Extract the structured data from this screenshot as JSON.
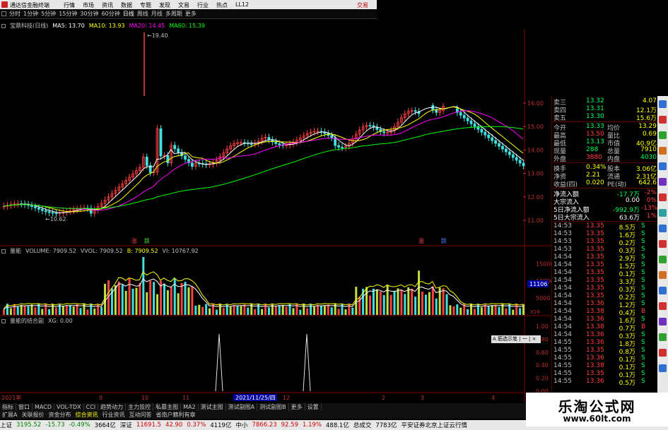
{
  "titlebar": {
    "title": "通达信金融终端",
    "menu": [
      "行情",
      "市场",
      "资讯",
      "数据",
      "专题",
      "发现",
      "文易",
      "行业",
      "热点",
      "LL12"
    ],
    "trade": "交易"
  },
  "toolbar": {
    "items": [
      "分时",
      "1分钟",
      "5分钟",
      "15分钟",
      "30分钟",
      "60分钟",
      "日线",
      "周线",
      "月线",
      "多周期",
      "更多"
    ],
    "selected_index": 6
  },
  "main_chart": {
    "stock": "宝鼎科技(日线)",
    "ma": [
      {
        "label": "MA5: 13.70",
        "color": "#ffffff"
      },
      {
        "label": "MA10: 13.93",
        "color": "#ffff00"
      },
      {
        "label": "MA20: 14.45",
        "color": "#ff00ff"
      },
      {
        "label": "MA60: 15.39",
        "color": "#00ff00"
      }
    ],
    "high_label": "19.40",
    "low_label": "10.62",
    "y_ticks": [
      "16.00",
      "15.00",
      "14.00",
      "13.00",
      "12.00",
      "11.00"
    ],
    "signal_marks": [
      "涨",
      "跌",
      "涨",
      "跌"
    ]
  },
  "volume_chart": {
    "title": "量能",
    "labels": [
      {
        "text": "VOLUME: 7909.52",
        "color": "#c0c0c0"
      },
      {
        "text": "VVOL: 7909.52",
        "color": "#c0c0c0"
      },
      {
        "text": "B: 7909.52",
        "color": "#ffff00"
      },
      {
        "text": "VI: 10767.92",
        "color": "#c0c0c0"
      }
    ],
    "y_ticks": [
      "15000",
      "10000",
      "5000"
    ],
    "highlight": "11106",
    "unit": "X10"
  },
  "signal_chart": {
    "title": "量能的结合副",
    "label": "XG: 0.00",
    "y_ticks": [
      "1.00",
      "0.80",
      "0.60",
      "0.40",
      "0.20",
      "0.00"
    ],
    "tooltip": "A 筋选示笔 | 一 | ×"
  },
  "date_axis": {
    "left": "2021年",
    "marks": [
      "9",
      "10",
      "11",
      "12",
      "2",
      "3",
      "4"
    ],
    "cursor": "2021/11/25/四"
  },
  "quotes": {
    "order_rows": [
      {
        "label": "卖三",
        "price": "13.32",
        "vol": "4.07"
      },
      {
        "label": "卖四",
        "price": "13.31",
        "vol": "12.1万"
      },
      {
        "label": "卖五",
        "price": "13.30",
        "vol": "15.6万"
      }
    ],
    "stats": [
      {
        "l1": "今开",
        "v1": "13.33",
        "l2": "均价",
        "v2": "13.29"
      },
      {
        "l1": "最高",
        "v1": "13.50",
        "l2": "量比",
        "v2": "0.69"
      },
      {
        "l1": "最低",
        "v1": "13.13",
        "l2": "市值",
        "v2": "40.9亿"
      },
      {
        "l1": "现量",
        "v1": "288",
        "l2": "总量",
        "v2": "7910"
      },
      {
        "l1": "外盘",
        "v1": "3880",
        "l2": "内盘",
        "v2": "4030"
      }
    ],
    "stats2": [
      {
        "l1": "换手",
        "v1": "0.34%",
        "l2": "股本",
        "v2": "3.06亿"
      },
      {
        "l1": "净资",
        "v1": "2.21",
        "l2": "流通",
        "v2": "2.31亿"
      },
      {
        "l1": "收益(四)",
        "v1": "0.020",
        "l2": "PE(动)",
        "v2": "642.6"
      }
    ],
    "flow": [
      {
        "label": "净流入额",
        "value": "-17.7万",
        "pct": "-2%"
      },
      {
        "label": "大宗流入",
        "value": "0.00",
        "pct": "0%"
      },
      {
        "label": "5日净流入额",
        "value": "-992.9万",
        "pct": "-13%"
      },
      {
        "label": "5日大宗流入",
        "value": "63.6万",
        "pct": "1%"
      }
    ],
    "ticks": [
      {
        "t": "14:53",
        "p": "13.35",
        "v": "8.5万",
        "d": "S"
      },
      {
        "t": "14:53",
        "p": "13.35",
        "v": "1.6万",
        "d": "S"
      },
      {
        "t": "14:53",
        "p": "13.35",
        "v": "0.2万",
        "d": "S"
      },
      {
        "t": "14:53",
        "p": "13.35",
        "v": "0.3万",
        "d": "S"
      },
      {
        "t": "14:54",
        "p": "13.35",
        "v": "2.9万",
        "d": "S"
      },
      {
        "t": "14:54",
        "p": "13.35",
        "v": "1.5万",
        "d": "S"
      },
      {
        "t": "14:54",
        "p": "13.35",
        "v": "0.1万",
        "d": "S"
      },
      {
        "t": "14:54",
        "p": "13.35",
        "v": "3.3万",
        "d": "S"
      },
      {
        "t": "14:54",
        "p": "13.35",
        "v": "0.3万",
        "d": "S"
      },
      {
        "t": "14:54",
        "p": "13.35",
        "v": "0.2万",
        "d": "S"
      },
      {
        "t": "14:54",
        "p": "13.36",
        "v": "1.2万",
        "d": "S"
      },
      {
        "t": "14:54",
        "p": "13.38",
        "v": "0.4万",
        "d": "B"
      },
      {
        "t": "14:54",
        "p": "13.36",
        "v": "1.6万",
        "d": "S"
      },
      {
        "t": "14:54",
        "p": "13.38",
        "v": "0.7万",
        "d": "B"
      },
      {
        "t": "14:54",
        "p": "13.36",
        "v": "0.3万",
        "d": "S"
      },
      {
        "t": "14:55",
        "p": "13.36",
        "v": "1.8万",
        "d": "S"
      },
      {
        "t": "14:55",
        "p": "13.35",
        "v": "0.8万",
        "d": "S"
      },
      {
        "t": "14:55",
        "p": "13.36",
        "v": "0.1万",
        "d": "S"
      },
      {
        "t": "14:55",
        "p": "13.38",
        "v": "0.1万",
        "d": "S"
      },
      {
        "t": "14:55",
        "p": "13.35",
        "v": "0.1万",
        "d": "S"
      },
      {
        "t": "14:55",
        "p": "13.36",
        "v": "0.5万",
        "d": "S"
      }
    ]
  },
  "tabs": [
    "指标",
    "窗口",
    "MACD",
    "VOL-TDX",
    "CCI",
    "趋势动力",
    "主力监控",
    "私募主图",
    "MA2",
    "测试主图",
    "测试副图A",
    "测试副图B",
    "更多",
    "设置"
  ],
  "tabs2": {
    "items": [
      "扩展A",
      "关联报价",
      "资金分布",
      "综合资讯",
      "行业资讯",
      "互动问答",
      "省南户籍利有章"
    ],
    "active_index": 3,
    "right": "模板"
  },
  "status": {
    "items": [
      {
        "text": "上证",
        "cls": ""
      },
      {
        "text": "3195.52",
        "cls": "dn"
      },
      {
        "text": "-15.73",
        "cls": "dn"
      },
      {
        "text": "-0.49%",
        "cls": "dn"
      },
      {
        "text": "3664亿",
        "cls": ""
      },
      {
        "text": "深证",
        "cls": ""
      },
      {
        "text": "11691.5",
        "cls": "up"
      },
      {
        "text": "42.90",
        "cls": "up"
      },
      {
        "text": "0.37%",
        "cls": "up"
      },
      {
        "text": "4119亿",
        "cls": ""
      },
      {
        "text": "中小",
        "cls": ""
      },
      {
        "text": "7866.23",
        "cls": "up"
      },
      {
        "text": "92.59",
        "cls": "up"
      },
      {
        "text": "1.19%",
        "cls": "up"
      },
      {
        "text": "488.1亿",
        "cls": ""
      },
      {
        "text": "总成交",
        "cls": ""
      },
      {
        "text": "7783亿",
        "cls": ""
      },
      {
        "text": "平安证券北京上证云行情",
        "cls": ""
      }
    ]
  },
  "watermark": {
    "line1": "乐淘公式网",
    "line2": "www.60lt.com"
  }
}
